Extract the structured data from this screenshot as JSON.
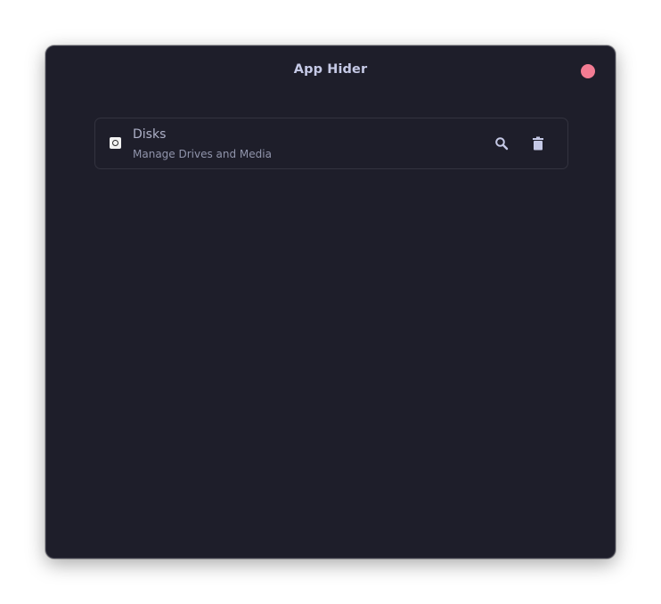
{
  "window": {
    "title": "App Hider"
  },
  "apps": [
    {
      "name": "Disks",
      "description": "Manage Drives and Media",
      "icon": "disk-icon"
    }
  ],
  "actions": {
    "search_icon": "search-icon",
    "delete_icon": "trash-icon"
  },
  "colors": {
    "window_bg": "#1e1e2a",
    "title": "#c5c9e6",
    "close_button": "#f37c93",
    "icon_fill": "#c5c9e6"
  }
}
